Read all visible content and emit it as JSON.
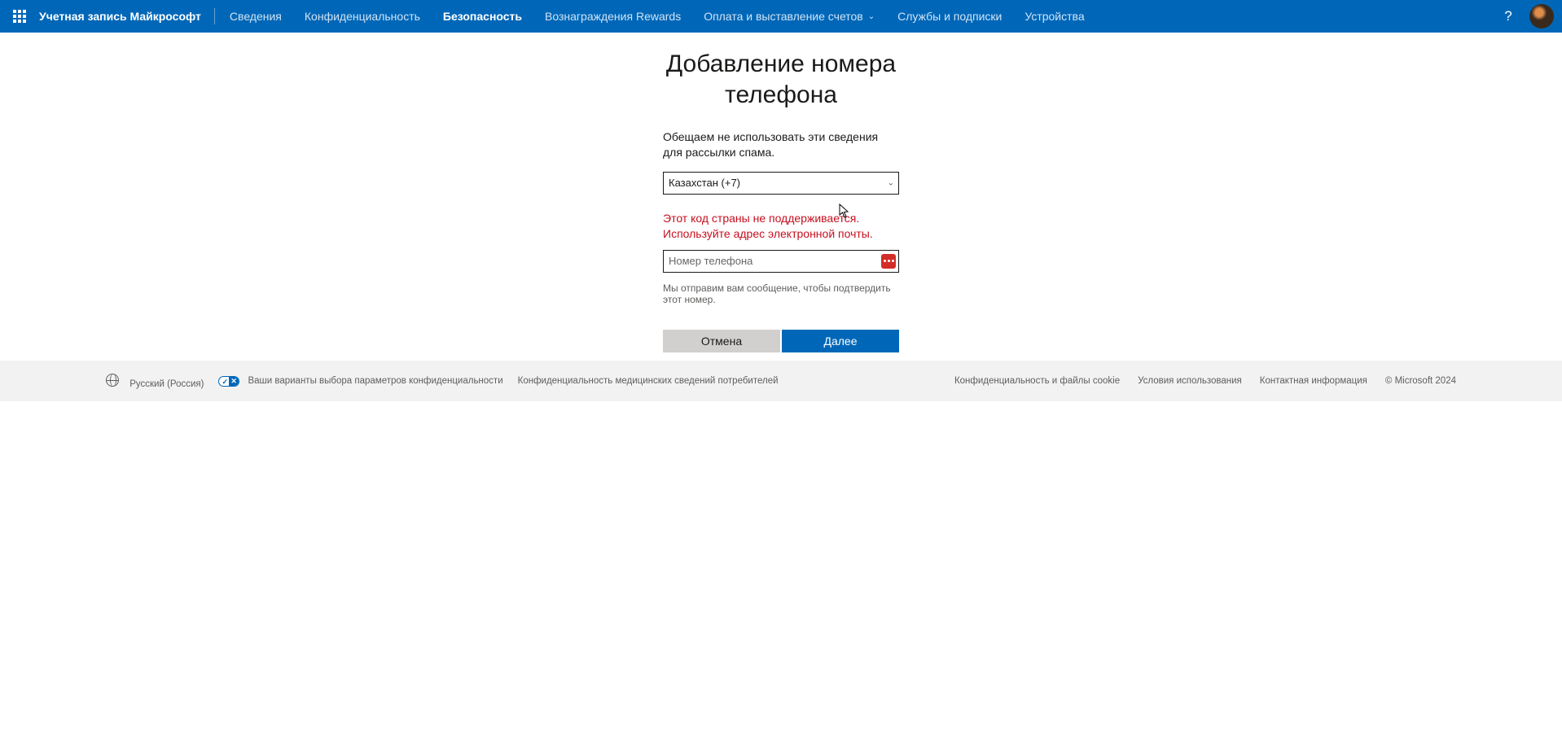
{
  "header": {
    "brand": "Учетная запись Майкрософт",
    "nav": {
      "info": "Сведения",
      "privacy": "Конфиденциальность",
      "security": "Безопасность",
      "rewards": "Вознаграждения Rewards",
      "billing": "Оплата и выставление счетов",
      "services": "Службы и подписки",
      "devices": "Устройства"
    },
    "help_tooltip": "?"
  },
  "page": {
    "title": "Добавление номера телефона",
    "description": "Обещаем не использовать эти сведения для рассылки спама.",
    "country_selected": "Казахстан (+7)",
    "error_message": "Этот код страны не поддерживается. Используйте адрес электронной почты.",
    "phone_placeholder": "Номер телефона",
    "phone_value": "",
    "hint": "Мы отправим вам сообщение, чтобы подтвердить этот номер.",
    "cancel_label": "Отмена",
    "next_label": "Далее"
  },
  "footer": {
    "language": "Русский (Россия)",
    "ccpa": "Ваши варианты выбора параметров конфиденциальности",
    "health_privacy": "Конфиденциальность медицинских сведений потребителей",
    "privacy_cookies": "Конфиденциальность и файлы cookie",
    "terms": "Условия использования",
    "contact": "Контактная информация",
    "copyright": "© Microsoft 2024"
  }
}
